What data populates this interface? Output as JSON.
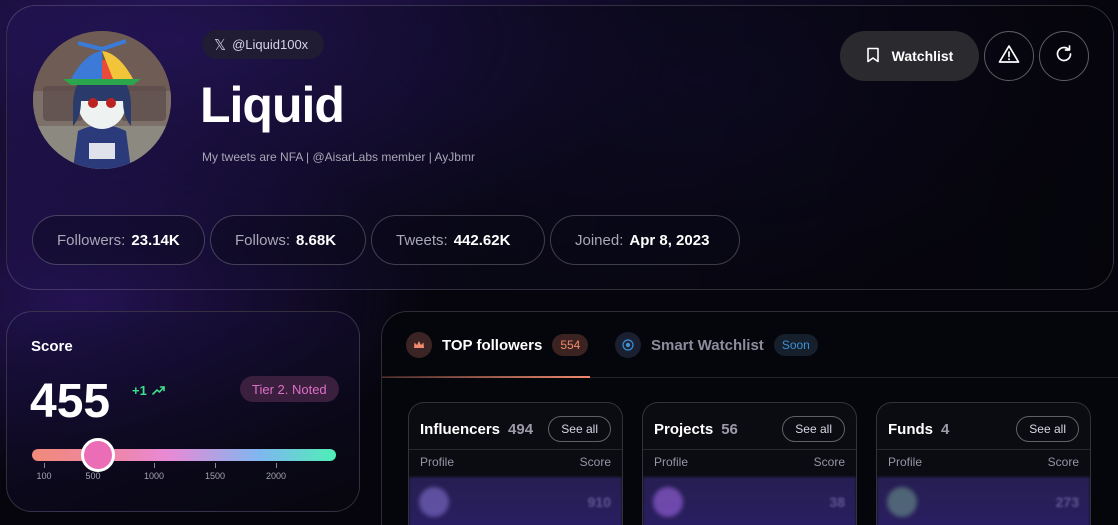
{
  "profile": {
    "handle": "@Liquid100x",
    "name": "Liquid",
    "bio": "My tweets are NFA | @AisarLabs member | AyJbmr",
    "actions": {
      "watchlist_label": "Watchlist"
    },
    "stats": [
      {
        "label": "Followers:",
        "value": "23.14K"
      },
      {
        "label": "Follows:",
        "value": "8.68K"
      },
      {
        "label": "Tweets:",
        "value": "442.62K"
      },
      {
        "label": "Joined:",
        "value": "Apr 8, 2023"
      }
    ]
  },
  "score": {
    "title": "Score",
    "value": "455",
    "delta": "+1",
    "tier": "Tier 2. Noted",
    "slider": {
      "min": 0,
      "max": 2500,
      "current": 455,
      "ticks": [
        "100",
        "500",
        "1000",
        "1500",
        "2000"
      ]
    }
  },
  "followers_panel": {
    "tabs": [
      {
        "label": "TOP followers",
        "count": "554",
        "active": true
      },
      {
        "label": "Smart Watchlist",
        "count": "Soon",
        "active": false
      }
    ],
    "categories": [
      {
        "title": "Influencers",
        "count": "494",
        "see_all": "See all",
        "col_profile": "Profile",
        "col_score": "Score",
        "first_score": "910"
      },
      {
        "title": "Projects",
        "count": "56",
        "see_all": "See all",
        "col_profile": "Profile",
        "col_score": "Score",
        "first_score": "38"
      },
      {
        "title": "Funds",
        "count": "4",
        "see_all": "See all",
        "col_profile": "Profile",
        "col_score": "Score",
        "first_score": "273"
      }
    ]
  },
  "colors": {
    "accent_green": "#3ee08c",
    "tier_pink": "#df6fc6",
    "tab_orange": "#f08a6e",
    "soon_blue": "#3d8fd6"
  },
  "icons": {
    "handle": "x-logo-icon",
    "watchlist": "bookmark-icon",
    "report": "warning-icon",
    "refresh": "refresh-icon",
    "top_followers": "crown-icon",
    "smart_watchlist": "target-icon",
    "delta": "trend-up-icon"
  }
}
